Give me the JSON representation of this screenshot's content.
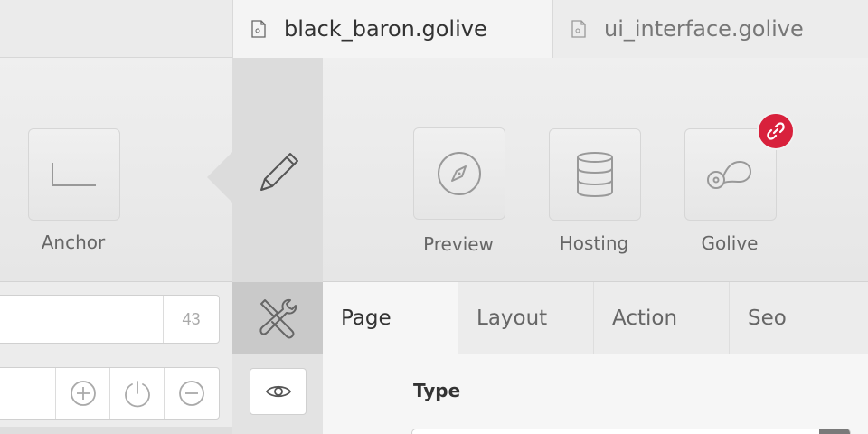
{
  "tabs": [
    {
      "label": "black_baron.golive",
      "icon": "document-icon",
      "active": true
    },
    {
      "label": "ui_interface.golive",
      "icon": "document-icon",
      "active": false
    }
  ],
  "toolbar": {
    "anchor_label": "Anchor",
    "preview_label": "Preview",
    "hosting_label": "Hosting",
    "golive_label": "Golive",
    "edit_icon": "pencil-icon",
    "badge_icon": "link-icon",
    "badge_color": "#d8213c"
  },
  "left_panel": {
    "count_value": "43",
    "controls": [
      "plus-circle-icon",
      "power-icon",
      "minus-circle-icon"
    ]
  },
  "panel_tabs": [
    {
      "label": "Page",
      "active": true
    },
    {
      "label": "Layout",
      "active": false
    },
    {
      "label": "Action",
      "active": false
    },
    {
      "label": "Seo",
      "active": false
    }
  ],
  "content": {
    "type_label": "Type"
  }
}
